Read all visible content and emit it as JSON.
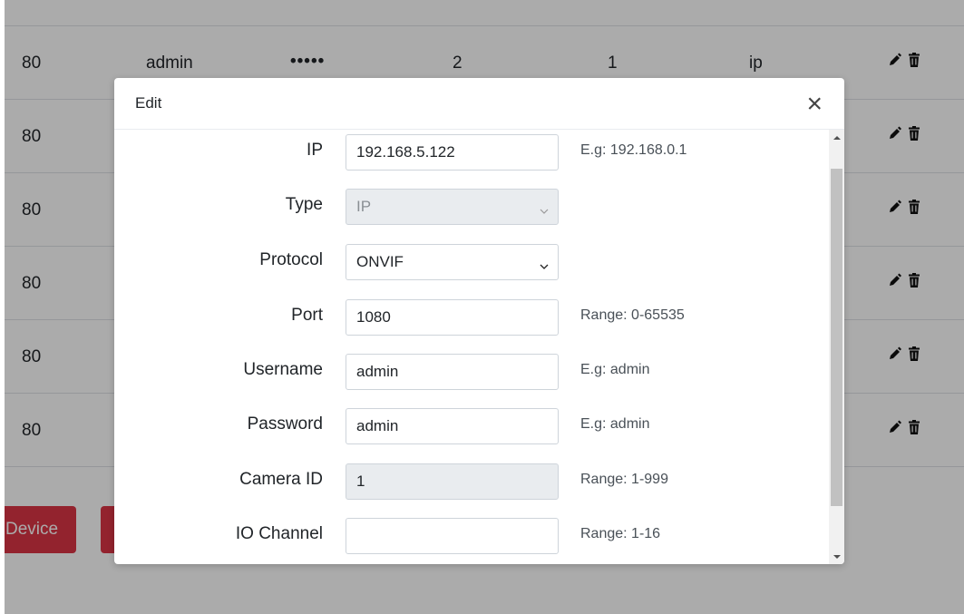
{
  "background_table": {
    "rows": [
      {
        "port": "80",
        "username": "admin",
        "password": "•••••",
        "col4": "2",
        "col5": "1",
        "type": "ip"
      },
      {
        "port": "80"
      },
      {
        "port": "80"
      },
      {
        "port": "80"
      },
      {
        "port": "80"
      },
      {
        "port": "80"
      }
    ]
  },
  "background_buttons": {
    "device_label": "Device"
  },
  "modal": {
    "title": "Edit",
    "close_symbol": "×",
    "fields": {
      "ip": {
        "label": "IP",
        "value": "192.168.5.122",
        "hint": "E.g: 192.168.0.1"
      },
      "type": {
        "label": "Type",
        "value": "IP",
        "hint": ""
      },
      "protocol": {
        "label": "Protocol",
        "value": "ONVIF",
        "hint": ""
      },
      "port": {
        "label": "Port",
        "value": "1080",
        "hint": "Range: 0-65535"
      },
      "username": {
        "label": "Username",
        "value": "admin",
        "hint": "E.g: admin"
      },
      "password": {
        "label": "Password",
        "value": "admin",
        "hint": "E.g: admin"
      },
      "camera_id": {
        "label": "Camera ID",
        "value": "1",
        "hint": "Range: 1-999"
      },
      "io_channel": {
        "label": "IO Channel",
        "value": "",
        "hint": "Range: 1-16"
      }
    }
  },
  "icons": {
    "edit": "pencil-icon",
    "delete": "trash-icon",
    "close": "close-icon",
    "caret": "chevron-down-icon"
  },
  "colors": {
    "danger": "#dc3545",
    "overlay": "rgba(0,0,0,0.33)",
    "disabled_bg": "#e9ecef"
  }
}
